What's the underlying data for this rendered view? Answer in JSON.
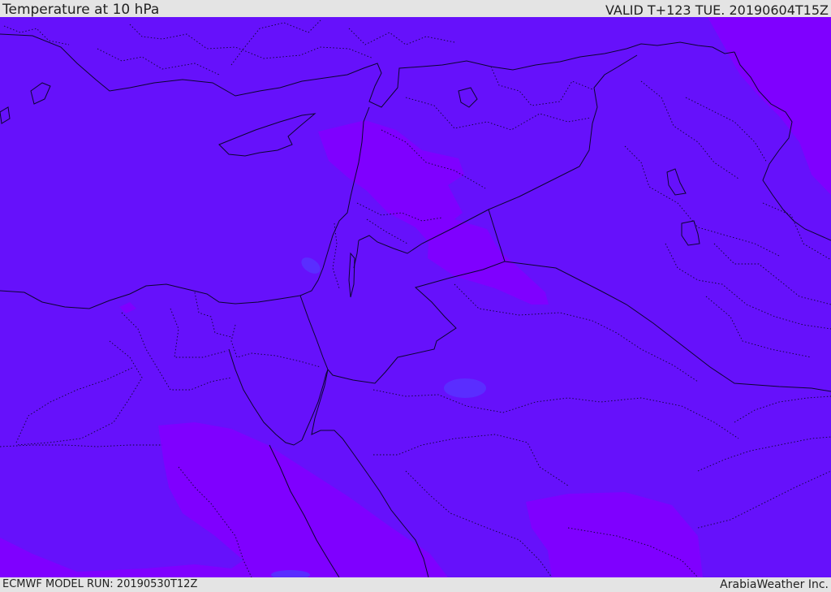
{
  "header": {
    "title": "Temperature at 10 hPa",
    "valid": "VALID T+123 TUE. 20190604T15Z"
  },
  "footer": {
    "model_run": "ECMWF MODEL RUN: 20190530T12Z",
    "credit": "ArabiaWeather Inc."
  },
  "colors": {
    "base_fill": "#6611fb",
    "warm_fill": "#7f00ff",
    "cool_fill": "#5a2dff",
    "outline": "#0c0530",
    "frame_bg": "#e4e4e4"
  }
}
